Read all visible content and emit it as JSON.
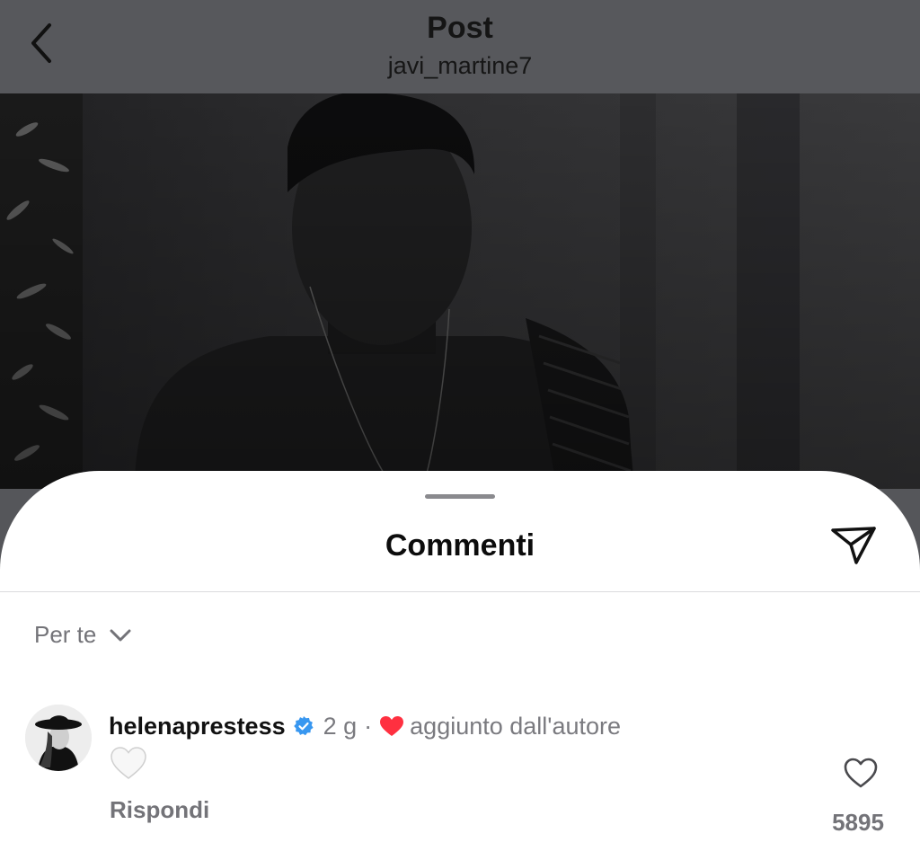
{
  "header": {
    "title": "Post",
    "username": "javi_martine7"
  },
  "sheet": {
    "title": "Commenti",
    "sort_label": "Per te"
  },
  "comments": [
    {
      "username": "helenaprestess",
      "verified": true,
      "time": "2 g",
      "separator": "·",
      "author_badge": "aggiunto dall'autore",
      "text": "🤍",
      "reply_label": "Rispondi",
      "likes": "5895"
    }
  ],
  "icons": {
    "back": "chevron-left-icon",
    "share": "paper-plane-icon",
    "sort": "chevron-down-icon",
    "verified": "verified-badge-icon",
    "author_heart": "heart-filled-icon",
    "like": "heart-outline-icon"
  },
  "colors": {
    "verified_blue": "#3897f0",
    "heart_red": "#ff3040",
    "muted_text": "#737378"
  }
}
